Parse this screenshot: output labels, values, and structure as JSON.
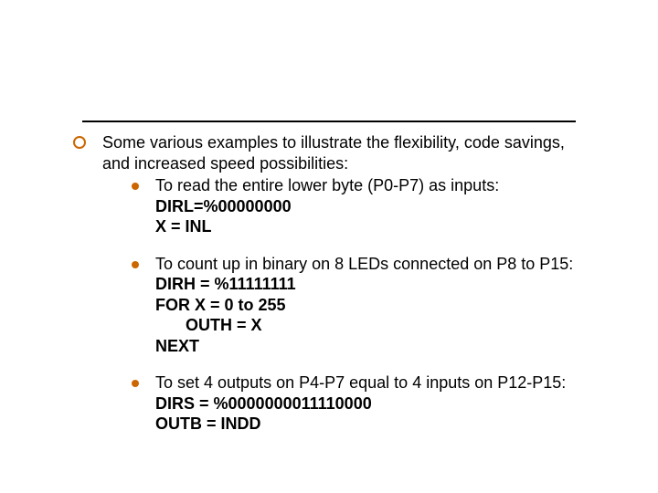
{
  "main": {
    "intro": "Some various examples to illustrate the flexibility, code savings, and increased speed possibilities:"
  },
  "items": [
    {
      "lead": "To read the entire lower byte (P0-P7) as inputs:",
      "code": [
        "DIRL=%00000000",
        "X = INL"
      ]
    },
    {
      "lead": "To count up in binary on 8 LEDs connected on P8 to P15:",
      "code": [
        "DIRH = %11111111",
        "FOR X = 0 to 255",
        "   OUTH = X",
        "NEXT"
      ]
    },
    {
      "lead": "To set 4 outputs on P4-P7 equal to 4 inputs on P12-P15:",
      "code": [
        "DIRS = %0000000011110000",
        "OUTB = INDD"
      ]
    }
  ]
}
